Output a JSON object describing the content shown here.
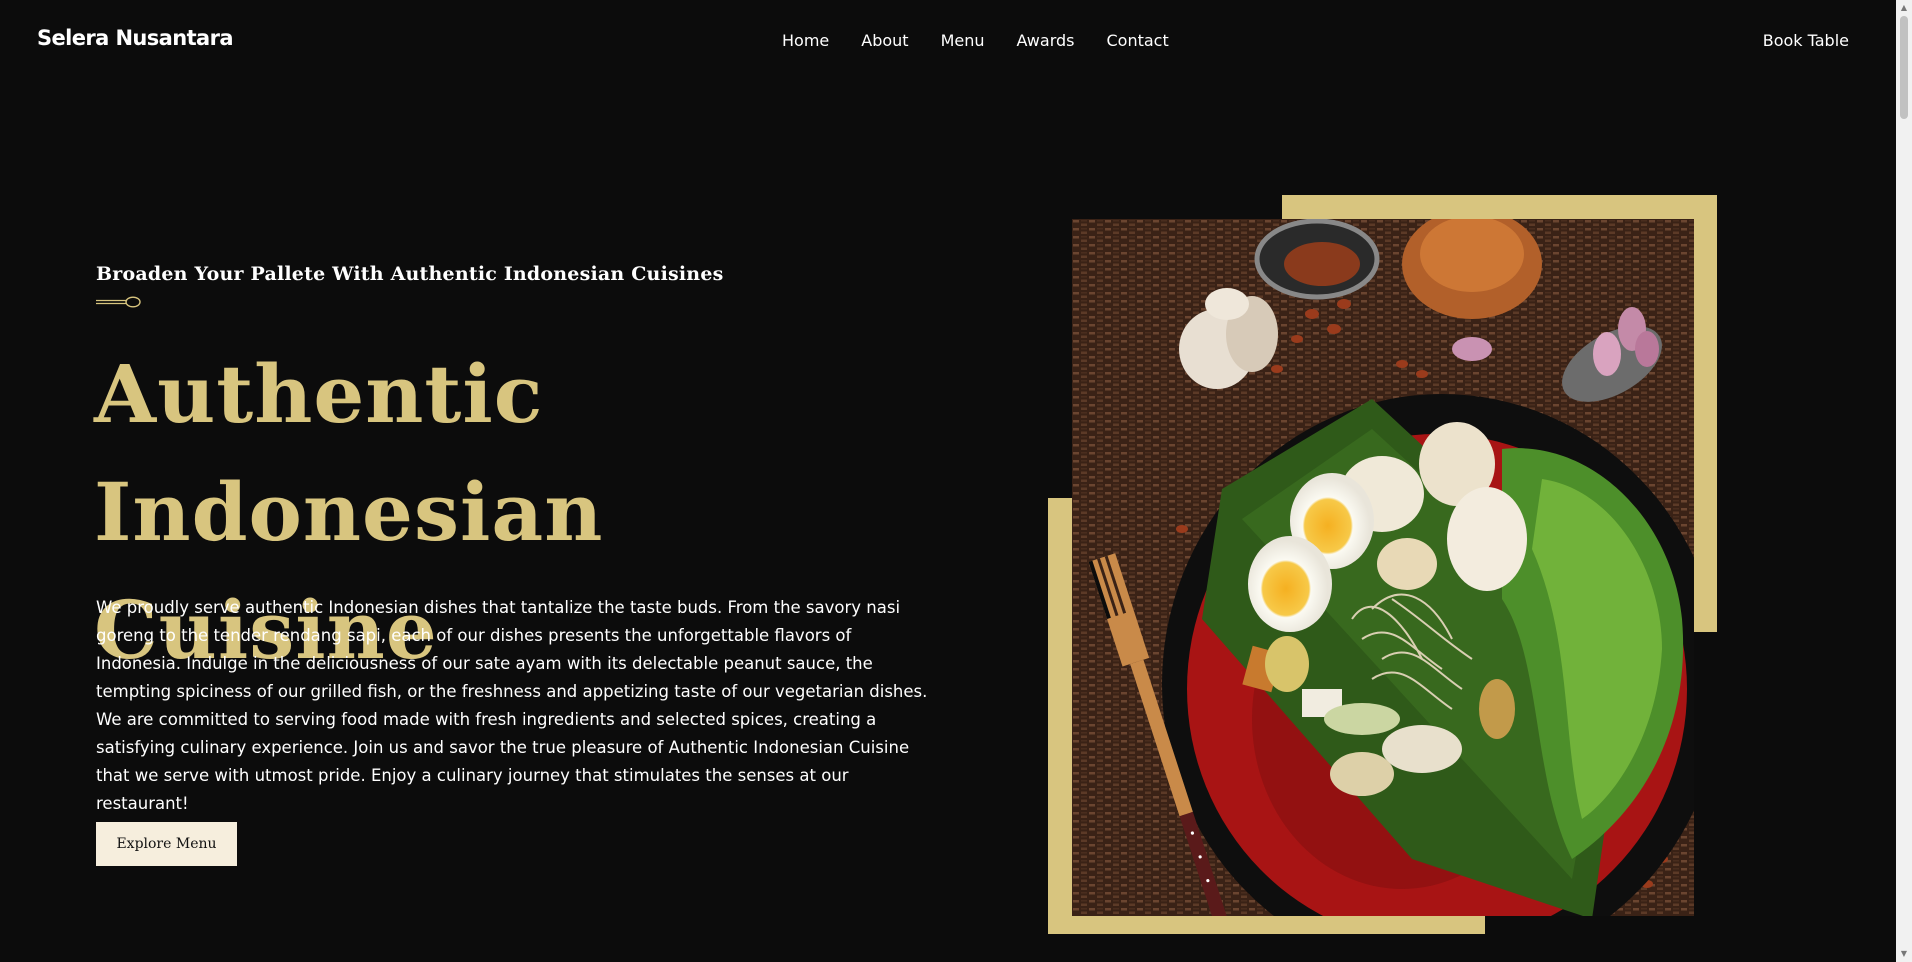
{
  "brand": {
    "name": "Selera Nusantara"
  },
  "nav": {
    "links": [
      "Home",
      "About",
      "Menu",
      "Awards",
      "Contact"
    ],
    "cta": "Book Table"
  },
  "hero": {
    "subtitle": "Broaden Your Pallete With Authentic Indonesian Cuisines",
    "headline_line1": "Authentic Indonesian",
    "headline_line2": "Cuisine",
    "description": "We proudly serve authentic Indonesian dishes that tantalize the taste buds. From the savory nasi goreng to the tender rendang sapi, each of our dishes presents the unforgettable flavors of Indonesia. Indulge in the deliciousness of our sate ayam with its delectable peanut sauce, the tempting spiciness of our grilled fish, or the freshness and appetizing taste of our vegetarian dishes. We are committed to serving food made with fresh ingredients and selected spices, creating a satisfying culinary experience. Join us and savor the true pleasure of Authentic Indonesian Cuisine that we serve with utmost pride. Enjoy a culinary journey that stimulates the senses at our restaurant!",
    "button": "Explore Menu"
  },
  "colors": {
    "background": "#0c0c0c",
    "accent_gold": "#d8c57f",
    "button_bg": "#f6eedd"
  },
  "icons": {
    "divider": "spoon-icon",
    "scroll_up": "chevron-up-icon",
    "scroll_down": "chevron-down-icon"
  }
}
